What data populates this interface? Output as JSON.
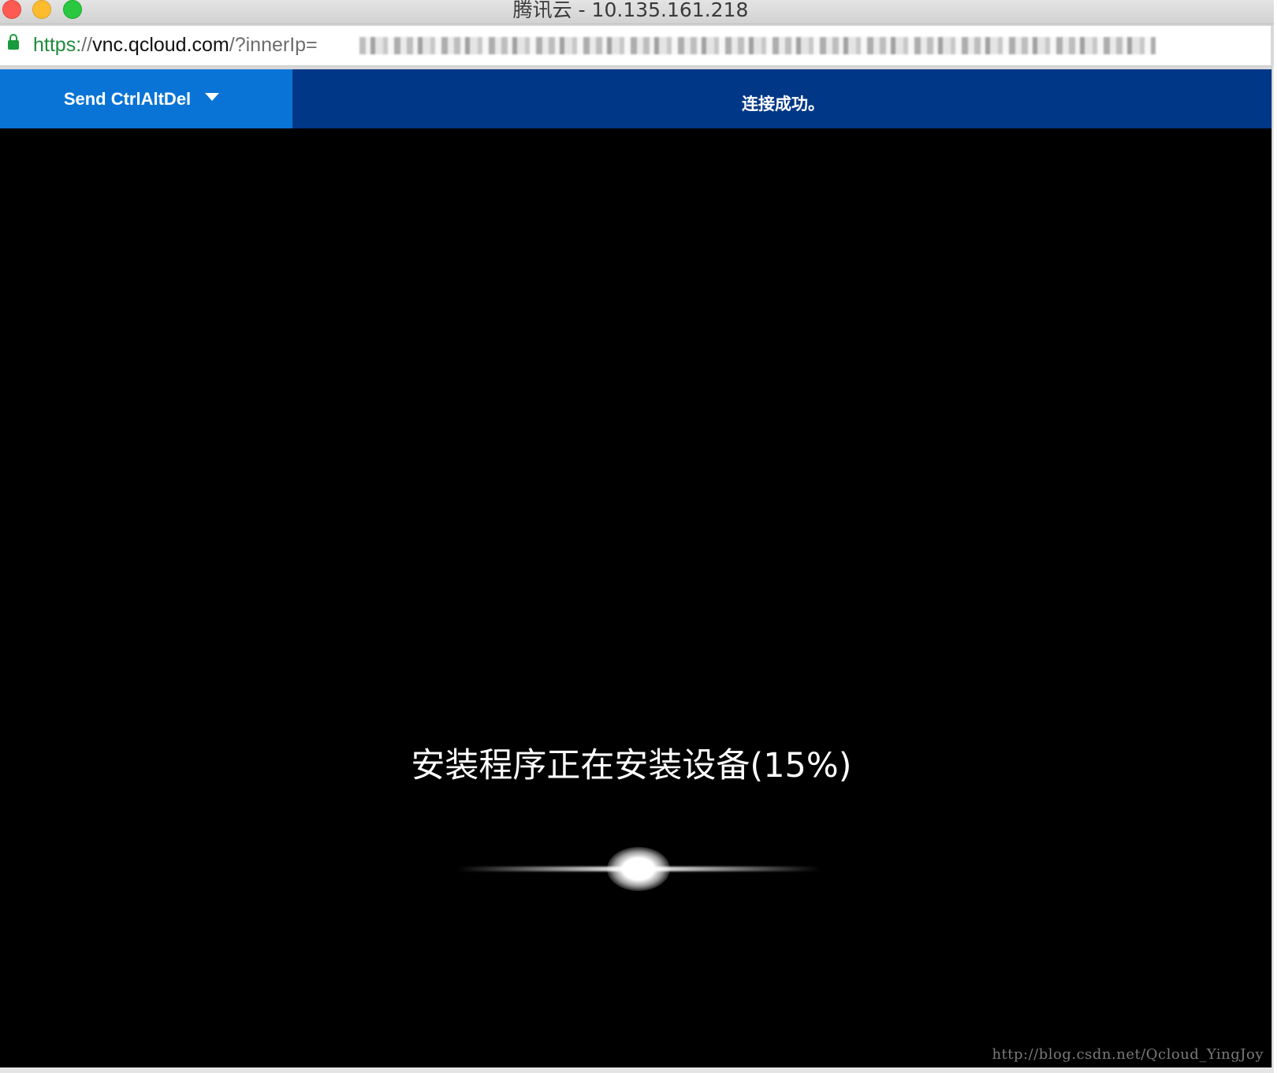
{
  "window": {
    "title": "腾讯云 - 10.135.161.218"
  },
  "address_bar": {
    "scheme": "https:",
    "sep": "//",
    "host": "vnc.qcloud.com",
    "path": "/?innerIp="
  },
  "vnc_toolbar": {
    "send_ctrlaltdel_label": "Send CtrlAltDel",
    "status_message": "连接成功。"
  },
  "remote_screen": {
    "install_status": "安装程序正在安装设备(15%)",
    "progress_percent": 15
  },
  "watermark": "http://blog.csdn.net/Qcloud_YingJoy",
  "colors": {
    "toolbar_bg": "#003786",
    "button_bg": "#0a74d6",
    "screen_bg": "#000000",
    "secure_scheme": "#1e8a3a"
  },
  "icons": {
    "lock": "lock-icon",
    "dropdown": "caret-down-icon"
  }
}
